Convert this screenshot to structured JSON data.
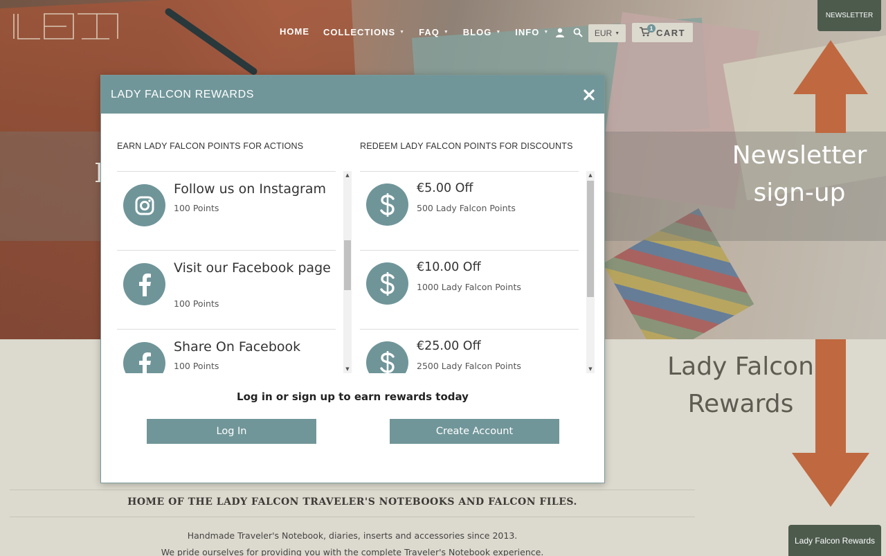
{
  "nav": {
    "items": [
      {
        "label": "HOME",
        "caret": false
      },
      {
        "label": "COLLECTIONS",
        "caret": true
      },
      {
        "label": "FAQ",
        "caret": true
      },
      {
        "label": "BLOG",
        "caret": true
      },
      {
        "label": "INFO",
        "caret": true
      }
    ],
    "currency": "EUR",
    "cart_label": "CART",
    "cart_count": "1"
  },
  "side_tabs": {
    "newsletter": "NEWSLETTER",
    "rewards": "Lady Falcon Rewards"
  },
  "annotations": {
    "newsletter_line1": "Newsletter",
    "newsletter_line2": "sign-up",
    "rewards_line1": "Lady Falcon",
    "rewards_line2": "Rewards",
    "arrow_color": "#c0683f"
  },
  "hero": {
    "title": "L"
  },
  "modal": {
    "title": "LADY FALCON REWARDS",
    "earn_title": "EARN LADY FALCON POINTS FOR ACTIONS",
    "redeem_title": "REDEEM LADY FALCON POINTS FOR DISCOUNTS",
    "earn_items": [
      {
        "title": "Follow us on Instagram",
        "points": "100 Points",
        "icon": "instagram-icon"
      },
      {
        "title": "Visit our Facebook page",
        "points": "100 Points",
        "icon": "facebook-icon"
      },
      {
        "title": "Share On Facebook",
        "points": "100 Points",
        "icon": "facebook-icon"
      }
    ],
    "redeem_items": [
      {
        "title": "€5.00 Off",
        "points": "500 Lady Falcon Points",
        "icon": "dollar-icon"
      },
      {
        "title": "€10.00 Off",
        "points": "1000 Lady Falcon Points",
        "icon": "dollar-icon"
      },
      {
        "title": "€25.00 Off",
        "points": "2500 Lady Falcon Points",
        "icon": "dollar-icon"
      }
    ],
    "cta_text": "Log in or sign up to earn rewards today",
    "login_label": "Log In",
    "create_label": "Create Account",
    "accent_color": "#719699"
  },
  "footer": {
    "tagline": "HOME OF THE LADY FALCON TRAVELER'S NOTEBOOKS AND FALCON FILES.",
    "line1": "Handmade Traveler's Notebook, diaries, inserts and accessories since 2013.",
    "line2": "We pride ourselves for providing you with the complete Traveler's Notebook experience."
  }
}
